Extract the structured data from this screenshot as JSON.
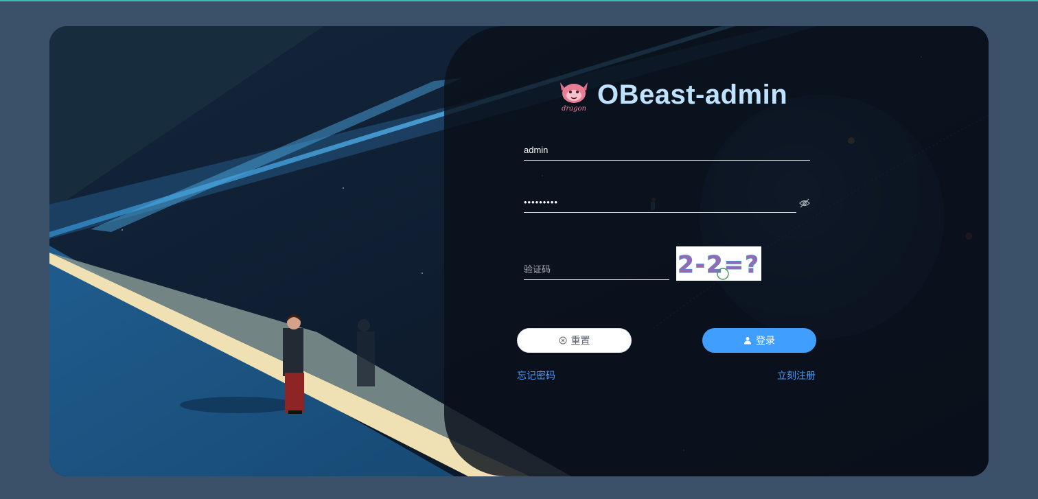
{
  "brand": {
    "logo_icon": "dragon-logo-icon",
    "logo_text": "dragon",
    "title": "OBeast-admin"
  },
  "form": {
    "username_value": "admin",
    "password_value": "•••••••••",
    "password_toggle_icon": "eye-hidden-icon",
    "captcha_placeholder": "验证码",
    "captcha_image_text": "2-2=?"
  },
  "buttons": {
    "reset_label": "重置",
    "reset_icon": "circle-close-icon",
    "login_label": "登录",
    "login_icon": "user-icon"
  },
  "links": {
    "forgot_password": "忘记密码",
    "register_now": "立刻注册"
  },
  "colors": {
    "page_background": "#3a5169",
    "accent": "#409eff",
    "title": "#bfe3ff",
    "top_line": "#3fbfb0"
  }
}
